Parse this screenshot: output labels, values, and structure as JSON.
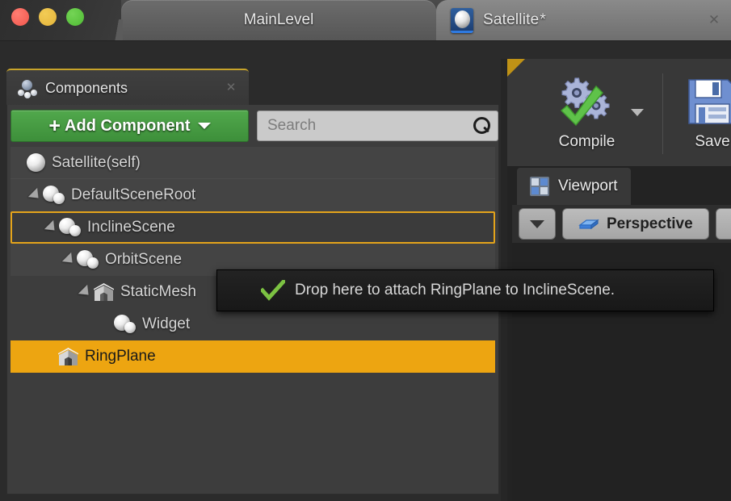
{
  "window": {
    "traffic_lights": [
      {
        "name": "close",
        "color": "#f2564c"
      },
      {
        "name": "minimize",
        "color": "#e4b43a"
      },
      {
        "name": "zoom",
        "color": "#4fbb34"
      }
    ],
    "tabs": [
      {
        "label": "MainLevel",
        "active": false
      },
      {
        "label": "Satellite",
        "modified_marker": "*",
        "active": true
      }
    ],
    "close_glyph": "✕"
  },
  "components_panel": {
    "tab_title": "Components",
    "tab_icon": "components-icon",
    "close_glyph": "✕",
    "add_component": {
      "plus": "+",
      "label": "Add Component",
      "caret": "▾"
    },
    "search": {
      "value": "",
      "placeholder": "Search",
      "icon": "search-icon"
    },
    "tree": [
      {
        "label": "Satellite(self)",
        "indent": 0,
        "icon": "sphere",
        "expander": "none",
        "state": "alt"
      },
      {
        "label": "DefaultSceneRoot",
        "indent": 1,
        "icon": "scene",
        "expander": "expanded",
        "state": "alt"
      },
      {
        "label": "InclineScene",
        "indent": 2,
        "icon": "scene",
        "expander": "expanded",
        "state": "droptarget"
      },
      {
        "label": "OrbitScene",
        "indent": 3,
        "icon": "scene",
        "expander": "expanded",
        "state": "alt"
      },
      {
        "label": "StaticMesh",
        "indent": 4,
        "icon": "mesh",
        "expander": "expanded",
        "state": "plain"
      },
      {
        "label": "Widget",
        "indent": 5,
        "icon": "scene",
        "expander": "none",
        "state": "plain"
      },
      {
        "label": "RingPlane",
        "indent": 1,
        "icon": "mesh",
        "expander": "none",
        "state": "selected"
      }
    ]
  },
  "tooltip": {
    "icon": "check-icon",
    "text": "Drop here to attach RingPlane to InclineScene."
  },
  "toolbar": {
    "compile": {
      "label": "Compile",
      "icon": "compile-gears-icon",
      "caret": "▾"
    },
    "save": {
      "label": "Save",
      "icon": "floppy-disk-icon"
    }
  },
  "viewport": {
    "tab_label": "Viewport",
    "tab_icon": "viewport-grid-icon",
    "controls": {
      "menu_caret": "▾",
      "perspective_label": "Perspective",
      "perspective_icon": "perspective-box-icon"
    }
  },
  "colors": {
    "accent_orange": "#eda511",
    "drop_border": "#e4a41b",
    "add_button_green": "#51a84c",
    "check_green": "#7cc242",
    "tab_gold": "#c8a42a"
  }
}
